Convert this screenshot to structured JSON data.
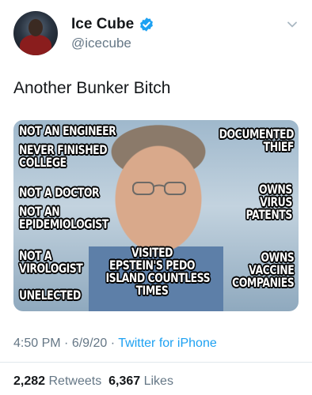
{
  "author": {
    "name": "Ice Cube",
    "handle": "@icecube",
    "verified": true
  },
  "tweet": {
    "text": "Another Bunker Bitch"
  },
  "image": {
    "captions": {
      "not_engineer": "NOT AN ENGINEER",
      "never_finished": "NEVER FINISHED\nCOLLEGE",
      "not_doctor": "NOT A DOCTOR",
      "not_epidemiologist": "NOT AN\nEPIDEMIOLOGIST",
      "not_virologist": "NOT A\nVIROLOGIST",
      "unelected": "UNELECTED",
      "documented_thief": "DOCUMENTED\nTHIEF",
      "owns_virus": "OWNS\nVIRUS\nPATENTS",
      "visited": "VISITED\nEPSTEIN'S PEDO\nISLAND COUNTLESS\nTIMES",
      "owns_vaccine": "OWNS\nVACCINE\nCOMPANIES"
    }
  },
  "meta": {
    "time": "4:50 PM",
    "date": "6/9/20",
    "separator": "·",
    "source": "Twitter for iPhone"
  },
  "stats": {
    "retweets_count": "2,282",
    "retweets_label": "Retweets",
    "likes_count": "6,367",
    "likes_label": "Likes"
  },
  "icons": {
    "verified": "verified-badge-icon",
    "more": "chevron-down-icon"
  },
  "colors": {
    "accent": "#1da1f2",
    "muted": "#657786",
    "text": "#14171a"
  }
}
